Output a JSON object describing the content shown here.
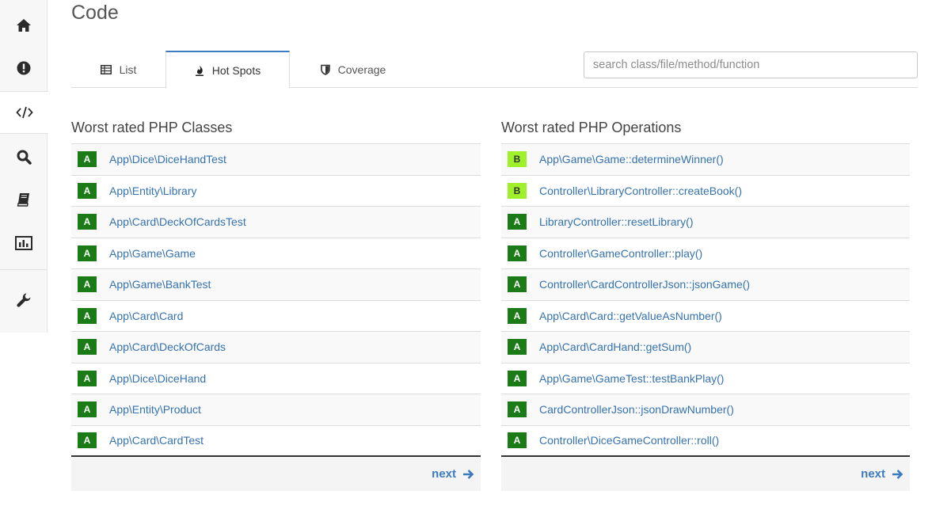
{
  "page": {
    "title": "Code"
  },
  "sidebar": {
    "items": [
      {
        "icon": "home-icon"
      },
      {
        "icon": "exclamation-circle-icon"
      },
      {
        "icon": "code-icon"
      },
      {
        "icon": "search-icon"
      },
      {
        "icon": "book-icon"
      },
      {
        "icon": "bar-chart-icon"
      },
      {
        "icon": "wrench-icon"
      }
    ],
    "active_index": 2
  },
  "tabs": [
    {
      "label": "List",
      "icon": "table-icon",
      "active": false
    },
    {
      "label": "Hot Spots",
      "icon": "fire-icon",
      "active": true
    },
    {
      "label": "Coverage",
      "icon": "shield-icon",
      "active": false
    }
  ],
  "search": {
    "placeholder": "search class/file/method/function",
    "value": ""
  },
  "classes": {
    "title": "Worst rated PHP Classes",
    "next_label": "next",
    "rows": [
      {
        "grade": "A",
        "name": "App\\Dice\\DiceHandTest"
      },
      {
        "grade": "A",
        "name": "App\\Entity\\Library"
      },
      {
        "grade": "A",
        "name": "App\\Card\\DeckOfCardsTest"
      },
      {
        "grade": "A",
        "name": "App\\Game\\Game"
      },
      {
        "grade": "A",
        "name": "App\\Game\\BankTest"
      },
      {
        "grade": "A",
        "name": "App\\Card\\Card"
      },
      {
        "grade": "A",
        "name": "App\\Card\\DeckOfCards"
      },
      {
        "grade": "A",
        "name": "App\\Dice\\DiceHand"
      },
      {
        "grade": "A",
        "name": "App\\Entity\\Product"
      },
      {
        "grade": "A",
        "name": "App\\Card\\CardTest"
      }
    ]
  },
  "operations": {
    "title": "Worst rated PHP Operations",
    "next_label": "next",
    "rows": [
      {
        "grade": "B",
        "name": "App\\Game\\Game::determineWinner()"
      },
      {
        "grade": "B",
        "name": "Controller\\LibraryController::createBook()"
      },
      {
        "grade": "A",
        "name": "LibraryController::resetLibrary()"
      },
      {
        "grade": "A",
        "name": "Controller\\GameController::play()"
      },
      {
        "grade": "A",
        "name": "Controller\\CardControllerJson::jsonGame()"
      },
      {
        "grade": "A",
        "name": "App\\Card\\Card::getValueAsNumber()"
      },
      {
        "grade": "A",
        "name": "App\\Card\\CardHand::getSum()"
      },
      {
        "grade": "A",
        "name": "App\\Game\\GameTest::testBankPlay()"
      },
      {
        "grade": "A",
        "name": "CardControllerJson::jsonDrawNumber()"
      },
      {
        "grade": "A",
        "name": "Controller\\DiceGameController::roll()"
      }
    ]
  },
  "colors": {
    "grade_A": "#1b7b16",
    "grade_B": "#9ef02a",
    "link": "#3572b0",
    "accent": "#3d7bc1"
  }
}
